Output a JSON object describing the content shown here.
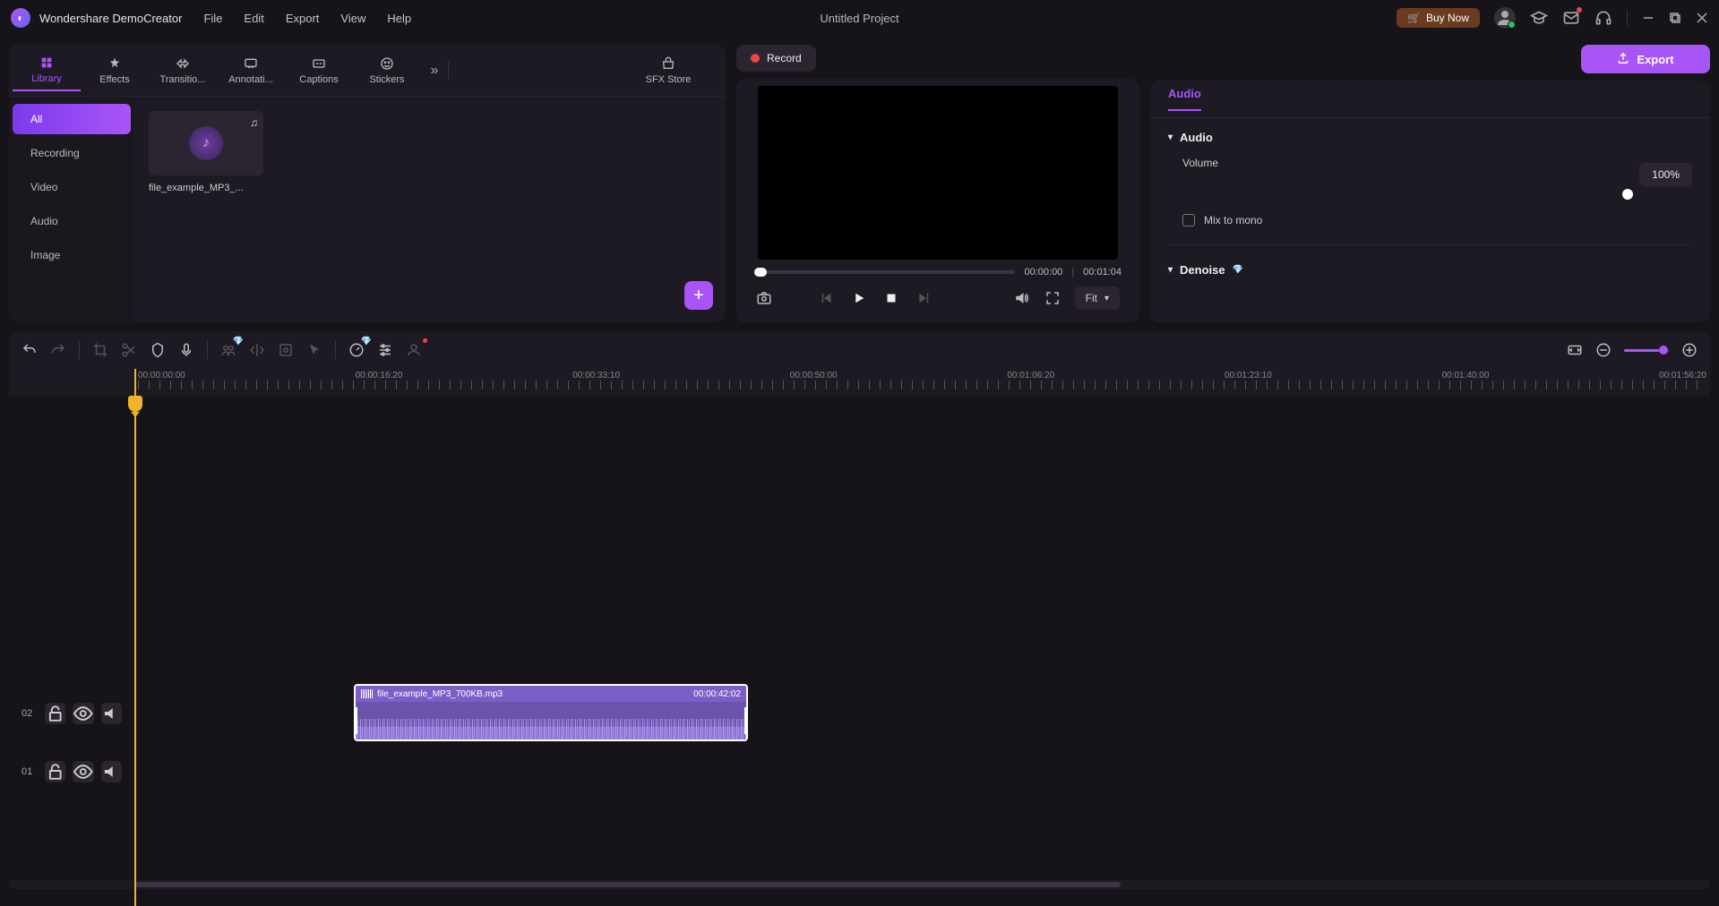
{
  "app": {
    "name": "Wondershare DemoCreator"
  },
  "menu": [
    "File",
    "Edit",
    "Export",
    "View",
    "Help"
  ],
  "project_title": "Untitled Project",
  "titlebar": {
    "buy_label": "Buy Now"
  },
  "export_btn": "Export",
  "record_btn": "Record",
  "lib_tabs": {
    "library": "Library",
    "effects": "Effects",
    "transitions": "Transitio...",
    "annotations": "Annotati...",
    "captions": "Captions",
    "stickers": "Stickers",
    "sfx": "SFX Store"
  },
  "lib_categories": [
    "All",
    "Recording",
    "Video",
    "Audio",
    "Image"
  ],
  "media_item": {
    "name": "file_example_MP3_..."
  },
  "preview": {
    "current_time": "00:00:00",
    "total_time": "00:01:04",
    "fit_label": "Fit"
  },
  "props": {
    "tab": "Audio",
    "section_audio": "Audio",
    "volume_label": "Volume",
    "volume_value": "100%",
    "mix_mono": "Mix to mono",
    "section_denoise": "Denoise"
  },
  "ruler_labels": [
    "00:00:00:00",
    "00:00:16:20",
    "00:00:33:10",
    "00:00:50:00",
    "00:01:06:20",
    "00:01:23:10",
    "00:01:40:00",
    "00:01:56:20"
  ],
  "tracks": {
    "row2": "02",
    "row1": "01"
  },
  "clip": {
    "name": "file_example_MP3_700KB.mp3",
    "duration": "00:00:42:02"
  }
}
